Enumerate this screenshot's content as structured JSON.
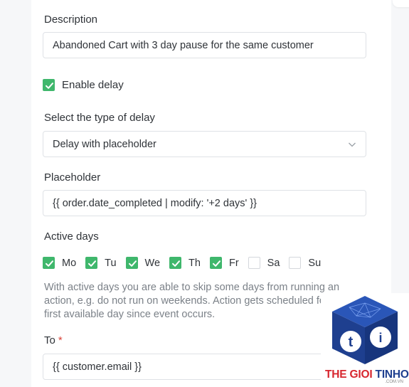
{
  "description": {
    "label": "Description",
    "value": "Abandoned Cart with 3 day pause for the same customer"
  },
  "enable_delay": {
    "label": "Enable delay",
    "checked": true
  },
  "delay_type": {
    "label": "Select the type of delay",
    "selected": "Delay with placeholder"
  },
  "placeholder": {
    "label": "Placeholder",
    "value": "{{ order.date_completed | modify: '+2 days' }}"
  },
  "active_days": {
    "label": "Active days",
    "days": [
      {
        "label": "Mo",
        "checked": true
      },
      {
        "label": "Tu",
        "checked": true
      },
      {
        "label": "We",
        "checked": true
      },
      {
        "label": "Th",
        "checked": true
      },
      {
        "label": "Fr",
        "checked": true
      },
      {
        "label": "Sa",
        "checked": false
      },
      {
        "label": "Su",
        "checked": false
      }
    ],
    "help": "With active days you are able to skip some days from running an action, e.g. do not run on weekends. Action gets scheduled for the first available day since event occurs."
  },
  "to": {
    "label": "To",
    "required_mark": "*",
    "value": "{{ customer.email }}"
  },
  "watermark": {
    "text_a": "THE GIOI",
    "text_b": "TINHOC",
    "sub": ".COM.VN",
    "colors": {
      "red": "#d7262e",
      "blue": "#1e3f8f"
    }
  },
  "colors": {
    "checkbox": "#3fb76c",
    "border": "#dfe2e6",
    "help_text": "#7b8188"
  }
}
